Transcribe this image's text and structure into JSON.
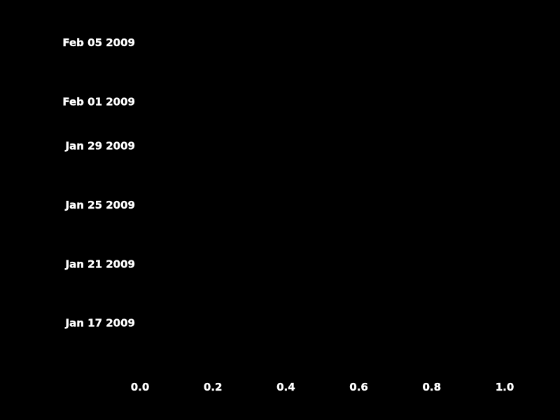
{
  "chart_data": {
    "type": "scatter",
    "title": "",
    "xlabel": "",
    "ylabel": "",
    "xlim": [
      0.0,
      1.0
    ],
    "ylim": [
      "Jan 14 2009",
      "Feb 06 2009"
    ],
    "x_ticks": [
      0.0,
      0.2,
      0.4,
      0.6,
      0.8,
      1.0
    ],
    "x_tick_labels": [
      "0.0",
      "0.2",
      "0.4",
      "0.6",
      "0.8",
      "1.0"
    ],
    "y_ticks": [
      "Jan 17 2009",
      "Jan 21 2009",
      "Jan 25 2009",
      "Jan 29 2009",
      "Feb 01 2009",
      "Feb 05 2009"
    ],
    "y_tick_labels": [
      "Jan 17 2009",
      "Jan 21 2009",
      "Jan 25 2009",
      "Jan 29 2009",
      "Feb 01 2009",
      "Feb 05 2009"
    ],
    "series": [],
    "background_color": "#000000",
    "text_color": "#ffffff",
    "grid": false,
    "axes_visible": false
  }
}
